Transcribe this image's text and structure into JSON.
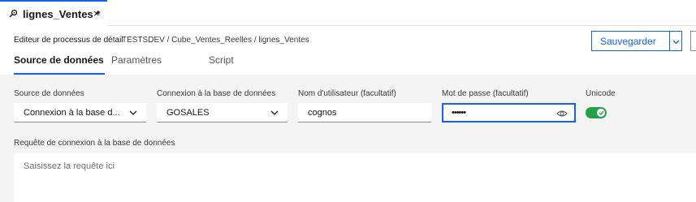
{
  "document_tab": {
    "title": "lignes_Ventes *",
    "icon": "process-icon",
    "close_glyph": "×"
  },
  "header": {
    "editor_label": "Editeur de processus de détail",
    "breadcrumb": "TESTSDEV / Cube_Ventes_Reelles / lignes_Ventes",
    "save_label": "Sauvegarder"
  },
  "subtabs": [
    {
      "label": "Source de données",
      "active": true
    },
    {
      "label": "Paramètres",
      "active": false
    },
    {
      "label": "Script",
      "active": false
    }
  ],
  "form": {
    "source": {
      "label": "Source de données",
      "value": "Connexion à la base d..."
    },
    "connection": {
      "label": "Connexion à la base de données",
      "value": "GOSALES"
    },
    "username": {
      "label": "Nom d'utilisateur (facultatif)",
      "value": "cognos"
    },
    "password": {
      "label": "Mot de passe (facultatif)",
      "value": "••••••"
    },
    "unicode": {
      "label": "Unicode",
      "enabled": true
    },
    "query": {
      "label": "Requête de connexion à la base de données",
      "placeholder": "Saisissez la requête ici"
    }
  },
  "colors": {
    "accent": "#0f62fe",
    "toggle_on": "#24a148"
  }
}
